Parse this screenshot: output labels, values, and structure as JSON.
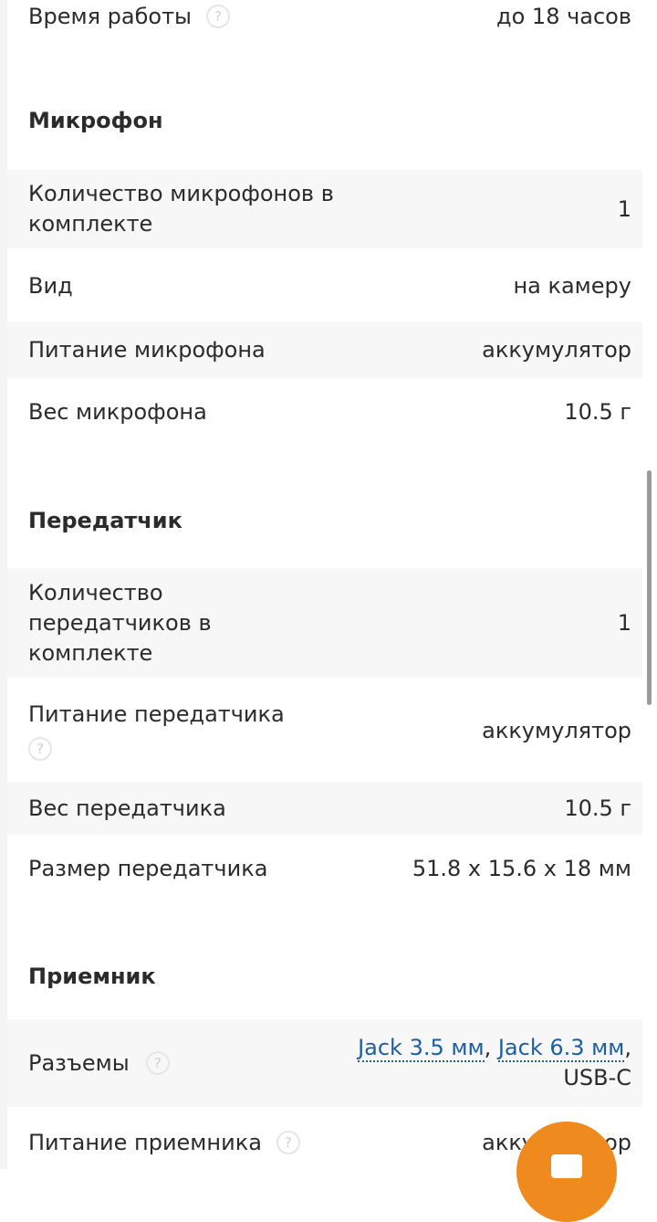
{
  "top_row": {
    "label": "Время работы",
    "value": "до 18 часов"
  },
  "microphone": {
    "title": "Микрофон",
    "count_label": "Количество микрофонов в комплекте",
    "count_value": "1",
    "type_label": "Вид",
    "type_value": "на камеру",
    "power_label": "Питание микрофона",
    "power_value": "аккумулятор",
    "weight_label": "Вес микрофона",
    "weight_value": "10.5 г"
  },
  "transmitter": {
    "title": "Передатчик",
    "count_label": "Количество передатчиков в комплекте",
    "count_value": "1",
    "power_label": "Питание передатчика",
    "power_value": "аккумулятор",
    "weight_label": "Вес передатчика",
    "weight_value": "10.5 г",
    "size_label": "Размер передатчика",
    "size_value": "51.8 x 15.6 x 18 мм"
  },
  "receiver": {
    "title": "Приемник",
    "connectors_label": "Разъемы",
    "connector_1": "Jack 3.5 мм",
    "connector_2": "Jack 6.3 мм",
    "connector_3": "USB-C",
    "power_label": "Питание приемника",
    "power_value": "аккумулятор"
  },
  "help_glyph": "?",
  "colors": {
    "link": "#1e5f9e",
    "fab": "#ef8a1f",
    "row_shade": "#f7f7f7"
  }
}
